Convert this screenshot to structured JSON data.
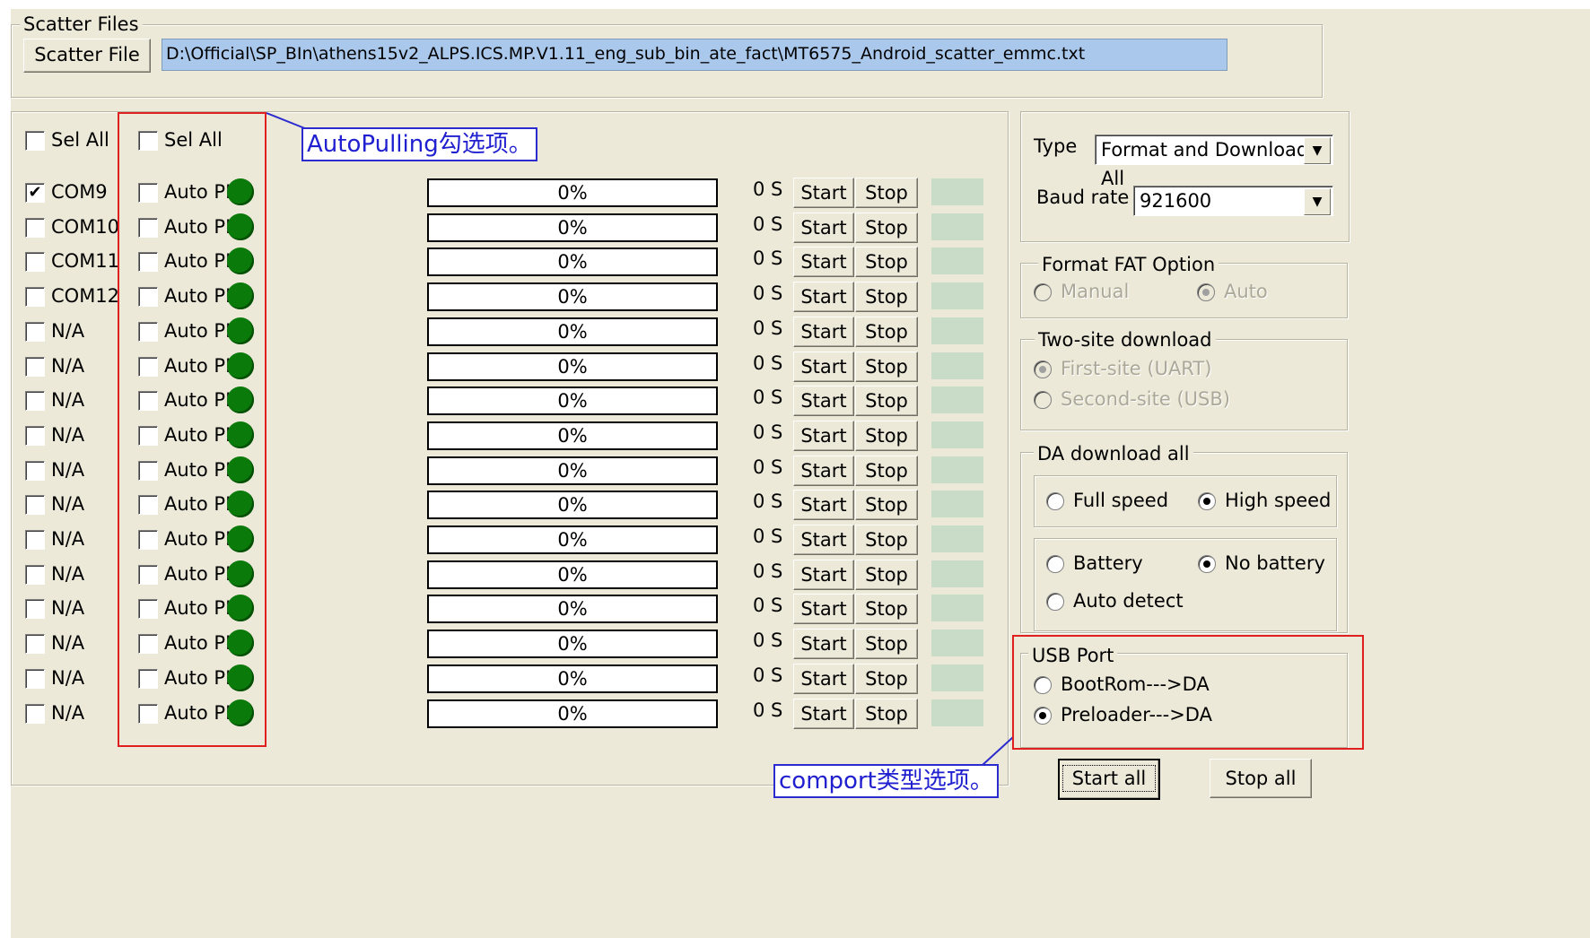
{
  "scatter": {
    "group_title": "Scatter Files",
    "button_label": "Scatter File",
    "path": "D:\\Official\\SP_BIn\\athens15v2_ALPS.ICS.MP.V1.11_eng_sub_bin_ate_fact\\MT6575_Android_scatter_emmc.txt"
  },
  "ports": {
    "sel_all_label": "Sel All",
    "autopull_sel_all_label": "Sel All",
    "rows": [
      {
        "port": "COM9",
        "checked": true,
        "auto": "Auto PL",
        "progress": "0%",
        "time": "0 S",
        "start": "Start",
        "stop": "Stop"
      },
      {
        "port": "COM10",
        "checked": false,
        "auto": "Auto PL",
        "progress": "0%",
        "time": "0 S",
        "start": "Start",
        "stop": "Stop"
      },
      {
        "port": "COM11",
        "checked": false,
        "auto": "Auto PL",
        "progress": "0%",
        "time": "0 S",
        "start": "Start",
        "stop": "Stop"
      },
      {
        "port": "COM12",
        "checked": false,
        "auto": "Auto PL",
        "progress": "0%",
        "time": "0 S",
        "start": "Start",
        "stop": "Stop"
      },
      {
        "port": "N/A",
        "checked": false,
        "auto": "Auto PL",
        "progress": "0%",
        "time": "0 S",
        "start": "Start",
        "stop": "Stop"
      },
      {
        "port": "N/A",
        "checked": false,
        "auto": "Auto PL",
        "progress": "0%",
        "time": "0 S",
        "start": "Start",
        "stop": "Stop"
      },
      {
        "port": "N/A",
        "checked": false,
        "auto": "Auto PL",
        "progress": "0%",
        "time": "0 S",
        "start": "Start",
        "stop": "Stop"
      },
      {
        "port": "N/A",
        "checked": false,
        "auto": "Auto PL",
        "progress": "0%",
        "time": "0 S",
        "start": "Start",
        "stop": "Stop"
      },
      {
        "port": "N/A",
        "checked": false,
        "auto": "Auto PL",
        "progress": "0%",
        "time": "0 S",
        "start": "Start",
        "stop": "Stop"
      },
      {
        "port": "N/A",
        "checked": false,
        "auto": "Auto PL",
        "progress": "0%",
        "time": "0 S",
        "start": "Start",
        "stop": "Stop"
      },
      {
        "port": "N/A",
        "checked": false,
        "auto": "Auto PL",
        "progress": "0%",
        "time": "0 S",
        "start": "Start",
        "stop": "Stop"
      },
      {
        "port": "N/A",
        "checked": false,
        "auto": "Auto PL",
        "progress": "0%",
        "time": "0 S",
        "start": "Start",
        "stop": "Stop"
      },
      {
        "port": "N/A",
        "checked": false,
        "auto": "Auto PL",
        "progress": "0%",
        "time": "0 S",
        "start": "Start",
        "stop": "Stop"
      },
      {
        "port": "N/A",
        "checked": false,
        "auto": "Auto PL",
        "progress": "0%",
        "time": "0 S",
        "start": "Start",
        "stop": "Stop"
      },
      {
        "port": "N/A",
        "checked": false,
        "auto": "Auto PL",
        "progress": "0%",
        "time": "0 S",
        "start": "Start",
        "stop": "Stop"
      },
      {
        "port": "N/A",
        "checked": false,
        "auto": "Auto PL",
        "progress": "0%",
        "time": "0 S",
        "start": "Start",
        "stop": "Stop"
      }
    ]
  },
  "settings": {
    "type_label": "Type",
    "type_value": "Format and Download All",
    "baud_label": "Baud rate",
    "baud_value": "921600",
    "format_fat": {
      "title": "Format FAT Option",
      "manual": "Manual",
      "auto": "Auto"
    },
    "two_site": {
      "title": "Two-site download",
      "first": "First-site (UART)",
      "second": "Second-site (USB)"
    },
    "da": {
      "title": "DA download all",
      "full": "Full speed",
      "high": "High speed",
      "battery": "Battery",
      "no_battery": "No battery",
      "auto_detect": "Auto detect"
    },
    "usb": {
      "title": "USB Port",
      "bootrom": "BootRom--->DA",
      "preloader": "Preloader--->DA"
    },
    "start_all": "Start all",
    "stop_all": "Stop all"
  },
  "annotations": {
    "autopulling": "AutoPulling勾选项。",
    "comport": "comport类型选项。"
  },
  "colors": {
    "led_green": "#0a7a0a",
    "path_highlight": "#a9c8ec",
    "annotation_red": "#e02020",
    "annotation_blue": "#2b2bd0"
  }
}
